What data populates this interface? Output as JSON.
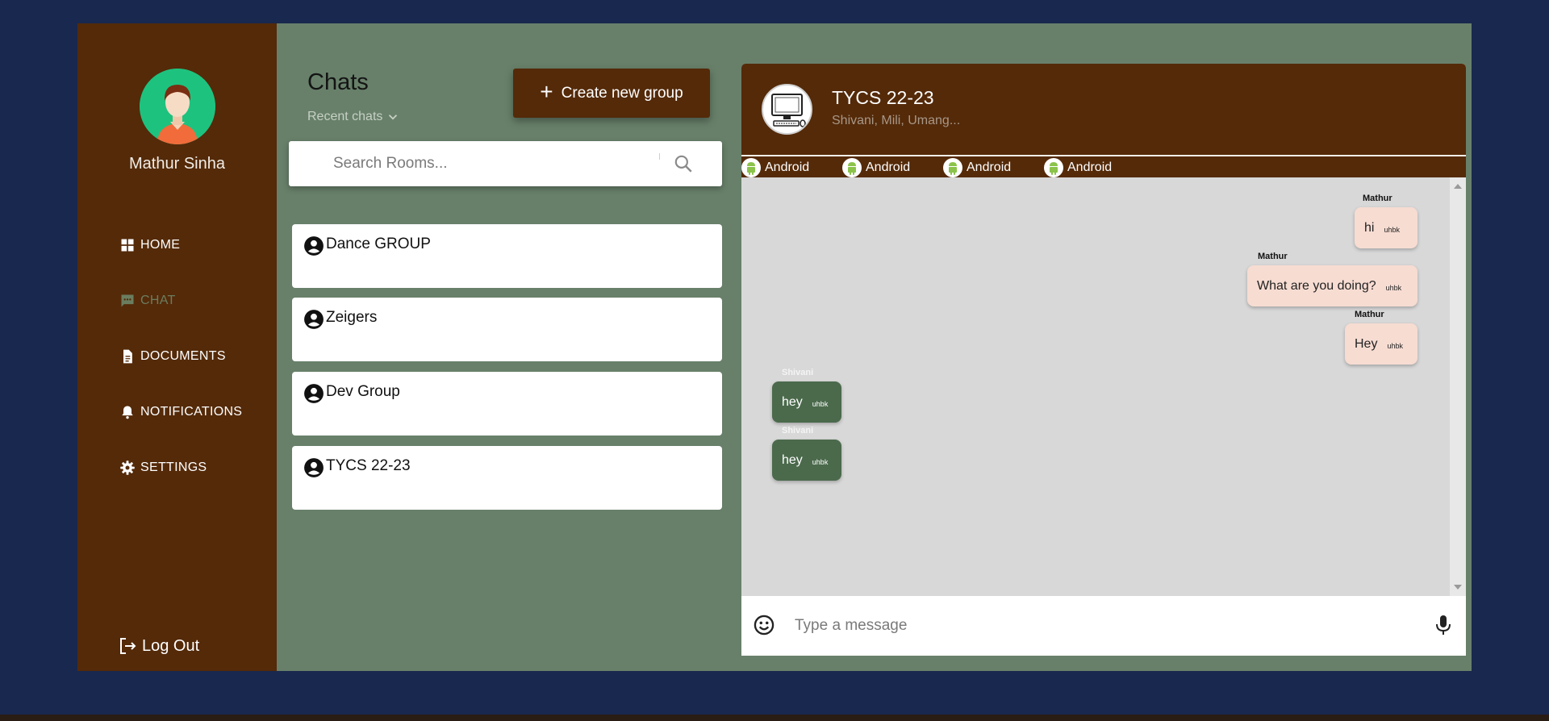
{
  "user": {
    "name": "Mathur Sinha"
  },
  "nav": {
    "items": [
      {
        "label": "HOME",
        "icon": "dashboard-icon"
      },
      {
        "label": "CHAT",
        "icon": "chat-icon",
        "active": true
      },
      {
        "label": "DOCUMENTS",
        "icon": "document-icon"
      },
      {
        "label": "NOTIFICATIONS",
        "icon": "bell-icon"
      },
      {
        "label": "SETTINGS",
        "icon": "gear-icon"
      }
    ],
    "logout_label": "Log Out"
  },
  "chats": {
    "title": "Chats",
    "filter_label": "Recent chats",
    "create_button_label": "Create new group",
    "search_placeholder": "Search Rooms...",
    "rooms": [
      {
        "name": "Dance GROUP"
      },
      {
        "name": "Zeigers"
      },
      {
        "name": "Dev Group"
      },
      {
        "name": "TYCS 22-23"
      }
    ]
  },
  "conversation": {
    "title": "TYCS 22-23",
    "members": "Shivani, Mili, Umang...",
    "tags": [
      "Android",
      "Android",
      "Android",
      "Android"
    ],
    "messages": [
      {
        "sender": "Mathur",
        "text": "hi",
        "time": "uhbk",
        "mine": true
      },
      {
        "sender": "Mathur",
        "text": "What are you doing?",
        "time": "uhbk",
        "mine": true
      },
      {
        "sender": "Mathur",
        "text": "Hey",
        "time": "uhbk",
        "mine": true
      },
      {
        "sender": "Shivani",
        "text": "hey",
        "time": "uhbk",
        "mine": false
      },
      {
        "sender": "Shivani",
        "text": "hey",
        "time": "uhbk",
        "mine": false
      }
    ],
    "composer_placeholder": "Type a message"
  },
  "colors": {
    "page_background": "#19284e",
    "sidebar": "#542a09",
    "content_background": "#68806a",
    "active_nav": "#6b7d5f",
    "my_bubble": "#f7dcd2",
    "their_bubble": "#4b6a4c",
    "messages_background": "#d8d8d8"
  }
}
